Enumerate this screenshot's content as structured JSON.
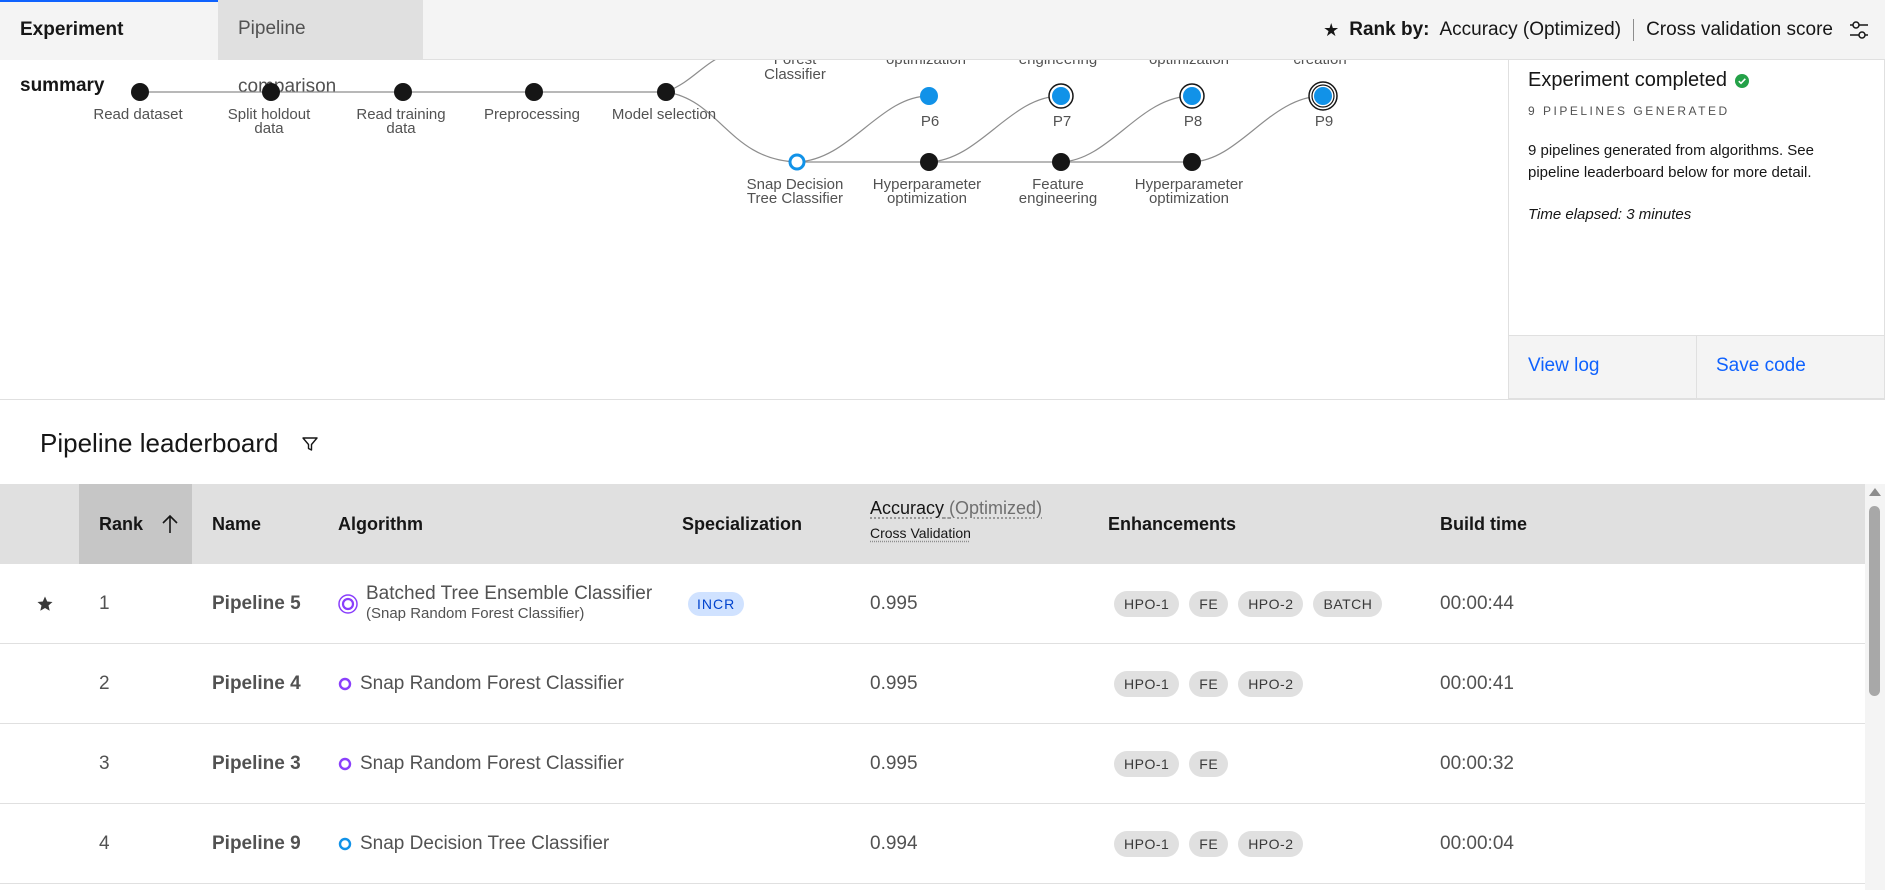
{
  "tabs": [
    {
      "label": "Experiment summary",
      "active": true
    },
    {
      "label": "Pipeline comparison",
      "active": false
    }
  ],
  "rank_by": {
    "label": "Rank by:",
    "metric": "Accuracy (Optimized)",
    "score": "Cross validation score"
  },
  "diagram": {
    "main_nodes": [
      "Read dataset",
      "Split holdout data",
      "Read training data",
      "Preprocessing",
      "Model selection"
    ],
    "top_partial_labels": [
      "Forest",
      "Classifier",
      "optimization",
      "engineering",
      "optimization",
      "creation"
    ],
    "pipeline_nodes": [
      "P6",
      "P7",
      "P8",
      "P9"
    ],
    "lower_nodes": [
      "Snap Decision Tree Classifier",
      "Hyperparameter optimization",
      "Feature engineering",
      "Hyperparameter optimization"
    ]
  },
  "status": {
    "title": "Experiment completed",
    "count": "9 PIPELINES GENERATED",
    "description": "9 pipelines generated from algorithms. See pipeline leaderboard below for more detail.",
    "elapsed": "Time elapsed: 3 minutes",
    "view_log": "View log",
    "save_code": "Save code"
  },
  "leaderboard": {
    "title": "Pipeline leaderboard",
    "columns": {
      "rank": "Rank",
      "name": "Name",
      "algorithm": "Algorithm",
      "specialization": "Specialization",
      "accuracy": "Accuracy",
      "accuracy_optimized": "(Optimized)",
      "accuracy_sub": "Cross Validation",
      "enhancements": "Enhancements",
      "build_time": "Build time"
    },
    "rows": [
      {
        "rank": "1",
        "name": "Pipeline 5",
        "algorithm": "Batched Tree Ensemble Classifier",
        "algorithm_sub": "(Snap Random Forest Classifier)",
        "specialization": "INCR",
        "accuracy": "0.995",
        "enhancements": [
          "HPO-1",
          "FE",
          "HPO-2",
          "BATCH"
        ],
        "build_time": "00:00:44",
        "starred": true,
        "dot": "double-purple"
      },
      {
        "rank": "2",
        "name": "Pipeline 4",
        "algorithm": "Snap Random Forest Classifier",
        "algorithm_sub": "",
        "specialization": "",
        "accuracy": "0.995",
        "enhancements": [
          "HPO-1",
          "FE",
          "HPO-2"
        ],
        "build_time": "00:00:41",
        "starred": false,
        "dot": "purple"
      },
      {
        "rank": "3",
        "name": "Pipeline 3",
        "algorithm": "Snap Random Forest Classifier",
        "algorithm_sub": "",
        "specialization": "",
        "accuracy": "0.995",
        "enhancements": [
          "HPO-1",
          "FE"
        ],
        "build_time": "00:00:32",
        "starred": false,
        "dot": "purple"
      },
      {
        "rank": "4",
        "name": "Pipeline 9",
        "algorithm": "Snap Decision Tree Classifier",
        "algorithm_sub": "",
        "specialization": "",
        "accuracy": "0.994",
        "enhancements": [
          "HPO-1",
          "FE",
          "HPO-2"
        ],
        "build_time": "00:00:04",
        "starred": false,
        "dot": "blue"
      }
    ]
  },
  "colors": {
    "accent_blue": "#0f62fe",
    "node_blue": "#1192e8",
    "purple": "#8a3ffc",
    "success_green": "#24a148"
  }
}
